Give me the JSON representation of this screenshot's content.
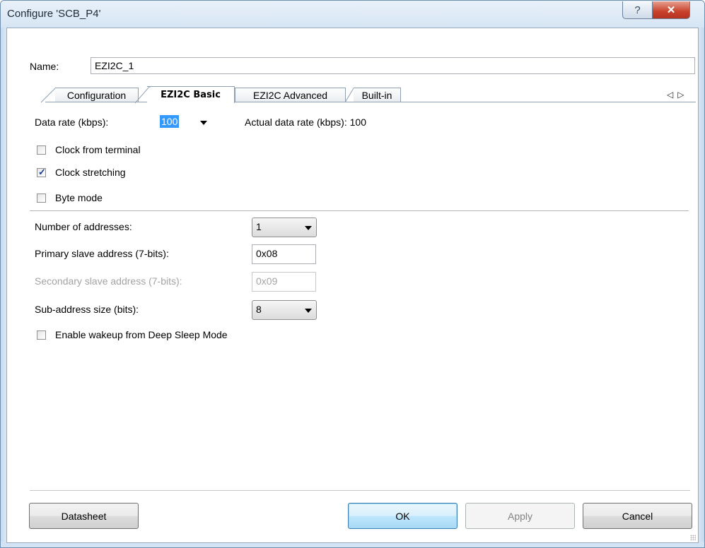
{
  "window": {
    "title": "Configure 'SCB_P4'",
    "help_glyph": "?",
    "close_glyph": "✕"
  },
  "name": {
    "label": "Name:",
    "value": "EZI2C_1"
  },
  "tabs": [
    {
      "label": "Configuration",
      "active": false
    },
    {
      "label": "EZI2C Basic",
      "active": true
    },
    {
      "label": "EZI2C Advanced",
      "active": false
    },
    {
      "label": "Built-in",
      "active": false
    }
  ],
  "tab_scroll": {
    "left": "◁",
    "right": "▷"
  },
  "basic": {
    "data_rate_label": "Data rate (kbps):",
    "data_rate_value": "100",
    "actual_rate_label": "Actual data rate (kbps): 100",
    "clock_from_terminal": {
      "label": "Clock from terminal",
      "checked": false
    },
    "clock_stretching": {
      "label": "Clock stretching",
      "checked": true
    },
    "byte_mode": {
      "label": "Byte mode",
      "checked": false
    },
    "num_addresses_label": "Number of addresses:",
    "num_addresses_value": "1",
    "primary_label": "Primary slave address (7-bits):",
    "primary_value": "0x08",
    "secondary_label": "Secondary slave address (7-bits):",
    "secondary_value": "0x09",
    "subaddr_label": "Sub-address size (bits):",
    "subaddr_value": "8",
    "wakeup": {
      "label": "Enable wakeup from Deep Sleep Mode",
      "checked": false
    }
  },
  "buttons": {
    "datasheet": "Datasheet",
    "ok": "OK",
    "apply": "Apply",
    "cancel": "Cancel"
  }
}
